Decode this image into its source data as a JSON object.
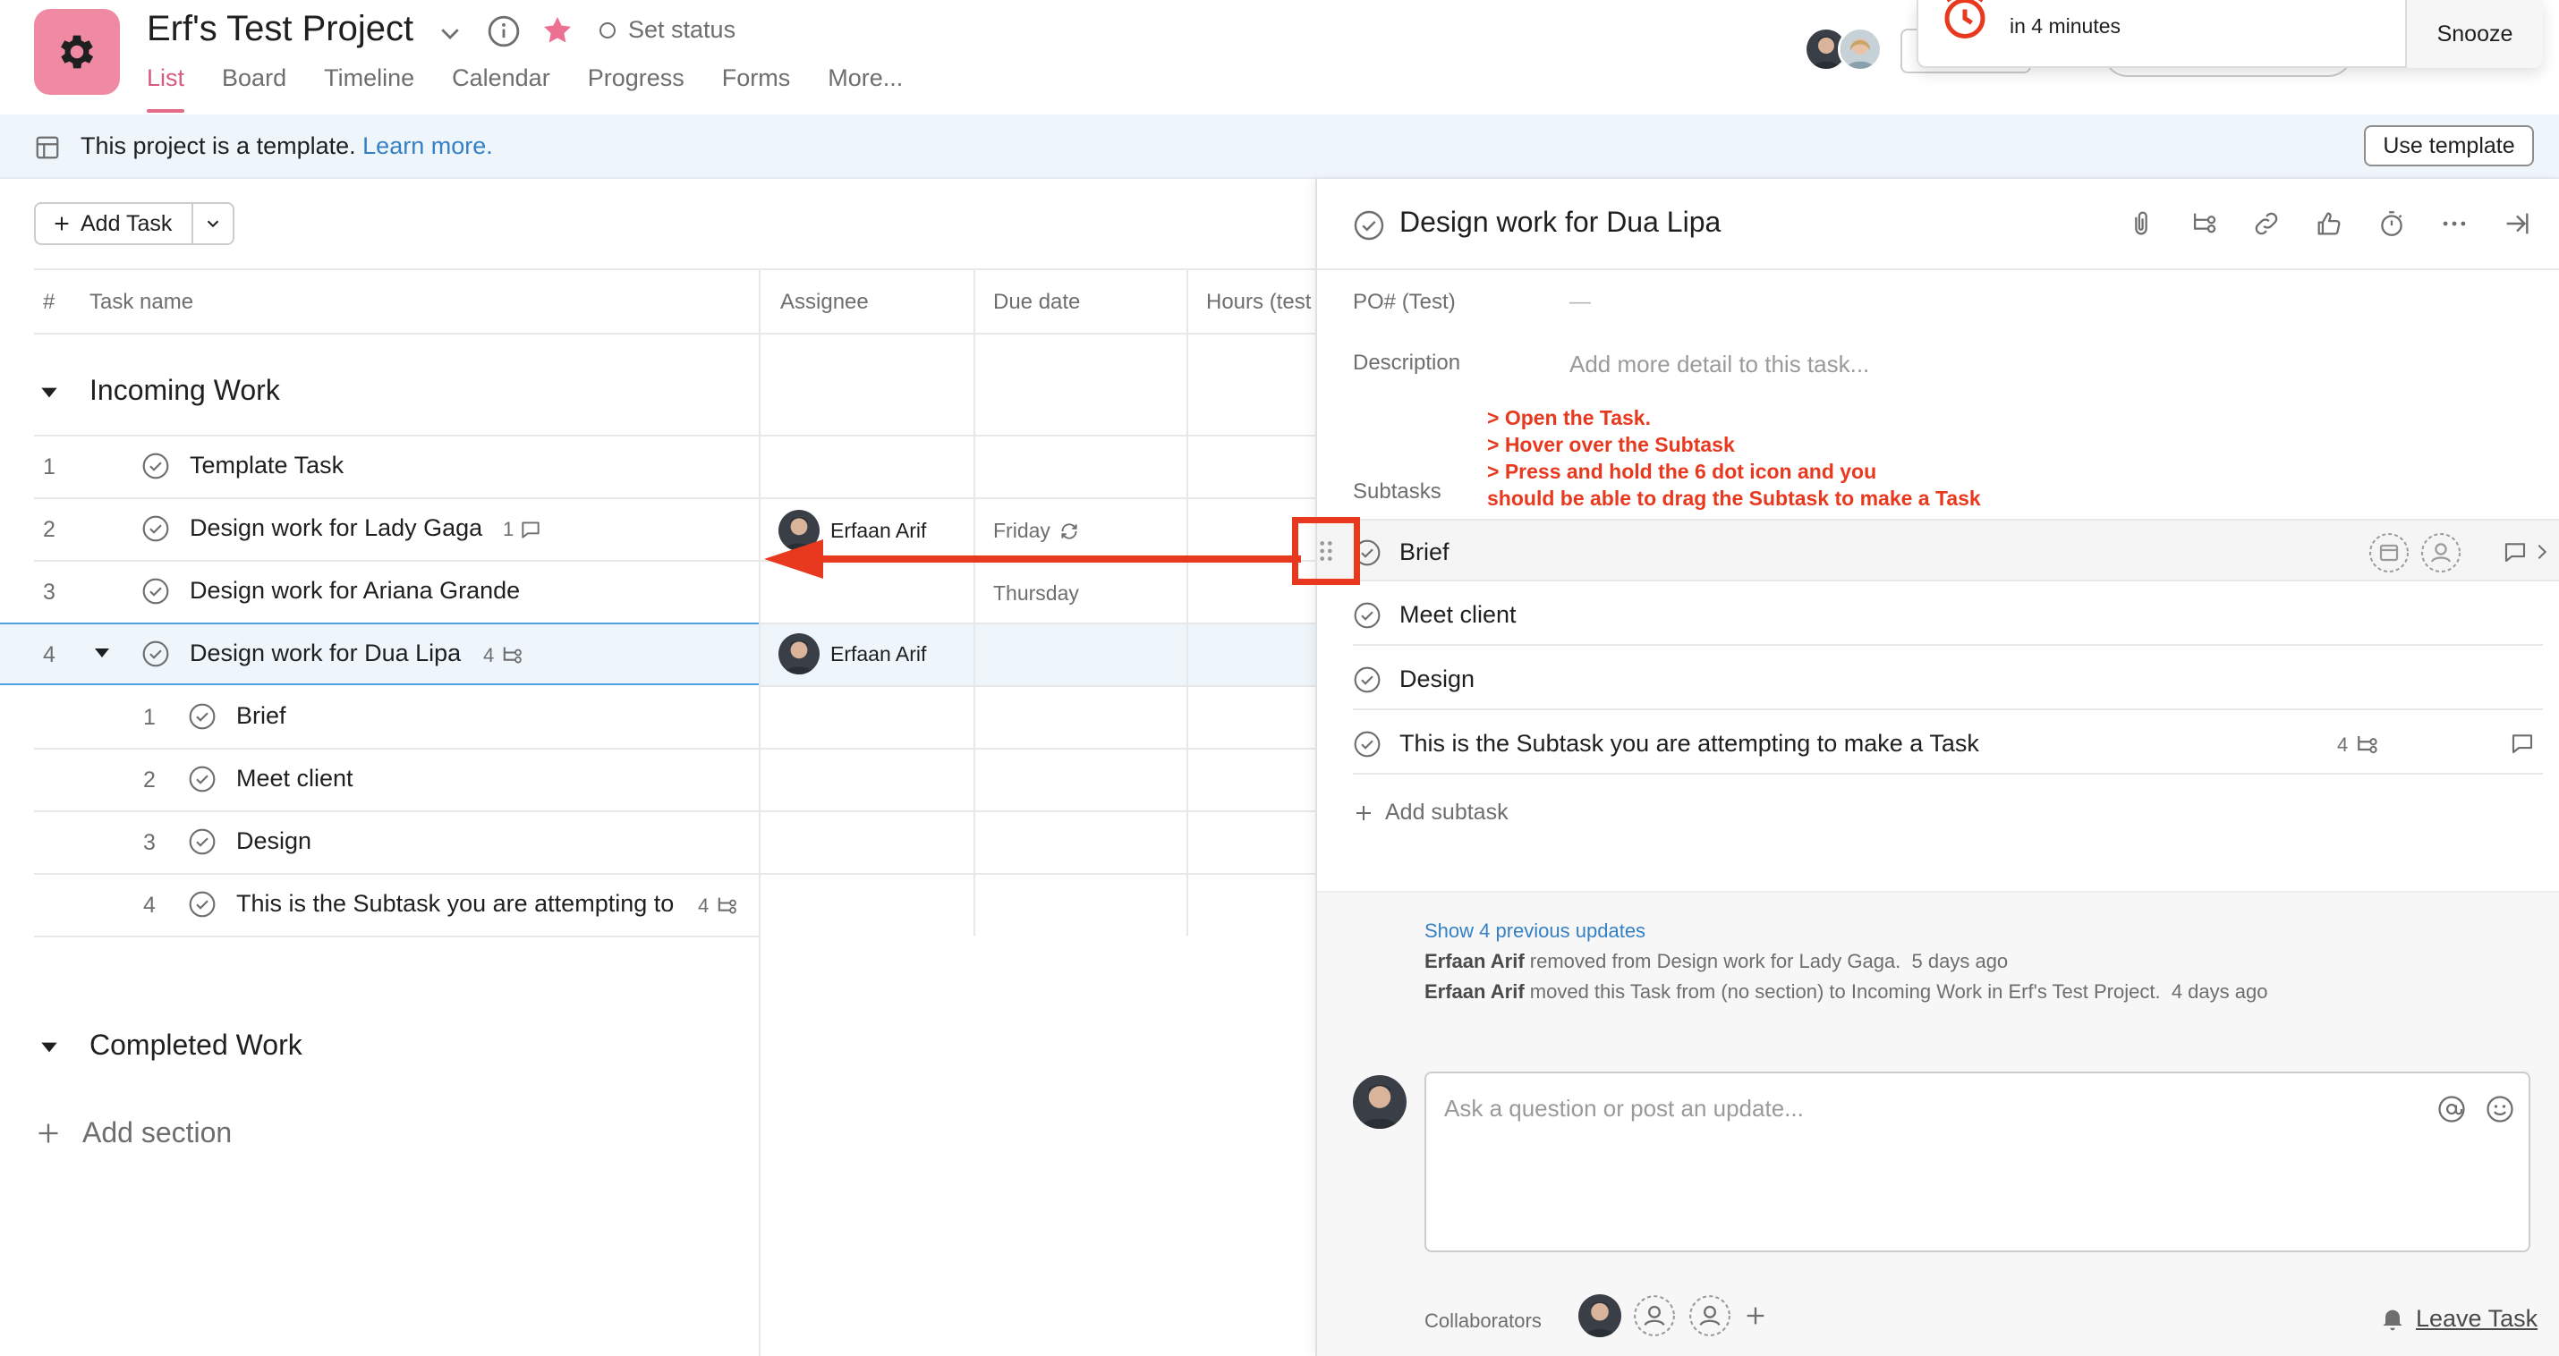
{
  "header": {
    "project_title": "Erf's Test Project",
    "set_status": "Set status",
    "tabs": [
      {
        "label": "List",
        "active": true
      },
      {
        "label": "Board"
      },
      {
        "label": "Timeline"
      },
      {
        "label": "Calendar"
      },
      {
        "label": "Progress"
      },
      {
        "label": "Forms"
      },
      {
        "label": "More..."
      }
    ],
    "reminder": {
      "time": "in 4 minutes",
      "snooze": "Snooze"
    }
  },
  "banner": {
    "text": "This project is a template.",
    "link": "Learn more.",
    "use_template": "Use template"
  },
  "list": {
    "add_task": "Add Task",
    "columns": {
      "num": "#",
      "task": "Task name",
      "assignee": "Assignee",
      "due": "Due date",
      "hours": "Hours (test"
    },
    "sections": [
      {
        "title": "Incoming Work",
        "rows": [
          {
            "num": "1",
            "name": "Template Task"
          },
          {
            "num": "2",
            "name": "Design work for Lady Gaga",
            "comments": "1",
            "assignee": "Erfaan Arif",
            "due": "Friday"
          },
          {
            "num": "3",
            "name": "Design work for Ariana Grande",
            "due": "Thursday"
          },
          {
            "num": "4",
            "name": "Design work for Dua Lipa",
            "subtasks": "4",
            "assignee": "Erfaan Arif",
            "children": [
              {
                "num": "1",
                "name": "Brief"
              },
              {
                "num": "2",
                "name": "Meet client"
              },
              {
                "num": "3",
                "name": "Design"
              },
              {
                "num": "4",
                "name": "This is the Subtask you are attempting to",
                "subtasks": "4"
              }
            ]
          }
        ]
      },
      {
        "title": "Completed Work"
      }
    ],
    "add_section": "Add section"
  },
  "detail": {
    "title": "Design work for Dua Lipa",
    "po_label": "PO# (Test)",
    "po_value": "—",
    "description_label": "Description",
    "description_placeholder": "Add more detail to this task...",
    "annotation": "> Open the Task.\n> Hover over the Subtask\n> Press and hold the 6 dot icon and you\nshould be able to drag the Subtask to make a Task",
    "subtasks_label": "Subtasks",
    "subtasks": [
      {
        "name": "Brief"
      },
      {
        "name": "Meet client"
      },
      {
        "name": "Design"
      },
      {
        "name": "This is the Subtask you are attempting to make a Task",
        "subtasks": "4"
      }
    ],
    "add_subtask": "Add subtask",
    "activity": {
      "show_previous": "Show 4 previous updates",
      "lines": [
        {
          "who": "Erfaan Arif",
          "what": "removed from Design work for Lady Gaga.",
          "when": "5 days ago"
        },
        {
          "who": "Erfaan Arif",
          "what": "moved this Task from (no section) to Incoming Work in Erf's Test Project.",
          "when": "4 days ago"
        }
      ]
    },
    "composer_placeholder": "Ask a question or post an update...",
    "collaborators_label": "Collaborators",
    "leave_task": "Leave Task"
  },
  "colors": {
    "accent": "#e36b87",
    "project_icon": "#f08aa2",
    "annotation_red": "#e8391f",
    "link_blue": "#3580c4",
    "banner_bg": "#eef6fc"
  }
}
